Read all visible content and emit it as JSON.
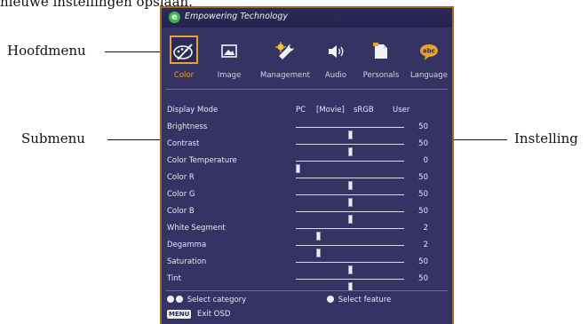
{
  "page": {
    "top_text": "nieuwe instellingen opslaan."
  },
  "callouts": {
    "main_menu": "Hoofdmenu",
    "submenu": "Submenu",
    "setting": "Instelling"
  },
  "osd": {
    "brand": "Empowering Technology",
    "tabs": [
      {
        "label": "Color",
        "icon": "palette-icon",
        "active": true
      },
      {
        "label": "Image",
        "icon": "picture-icon",
        "active": false
      },
      {
        "label": "Management",
        "icon": "wrench-icon",
        "active": false
      },
      {
        "label": "Audio",
        "icon": "speaker-icon",
        "active": false
      },
      {
        "label": "Personals",
        "icon": "document-icon",
        "active": false
      },
      {
        "label": "Language",
        "icon": "speech-bubble-icon",
        "active": false
      }
    ],
    "display_mode": {
      "label": "Display Mode",
      "options": [
        "PC",
        "[Movie]",
        "sRGB",
        "User"
      ]
    },
    "settings": [
      {
        "label": "Brightness",
        "value": "50",
        "level": 0.5
      },
      {
        "label": "Contrast",
        "value": "50",
        "level": 0.5
      },
      {
        "label": "Color Temperature",
        "value": "0",
        "level": 0.0
      },
      {
        "label": "Color R",
        "value": "50",
        "level": 0.5
      },
      {
        "label": "Color G",
        "value": "50",
        "level": 0.5
      },
      {
        "label": "Color B",
        "value": "50",
        "level": 0.5
      },
      {
        "label": "White Segment",
        "value": "2",
        "level": 0.2
      },
      {
        "label": "Degamma",
        "value": "2",
        "level": 0.2
      },
      {
        "label": "Saturation",
        "value": "50",
        "level": 0.5
      },
      {
        "label": "Tint",
        "value": "50",
        "level": 0.5
      }
    ],
    "footer": {
      "select_category": "Select category",
      "select_feature": "Select feature",
      "menu_key": "MENU",
      "exit": "Exit OSD"
    }
  }
}
